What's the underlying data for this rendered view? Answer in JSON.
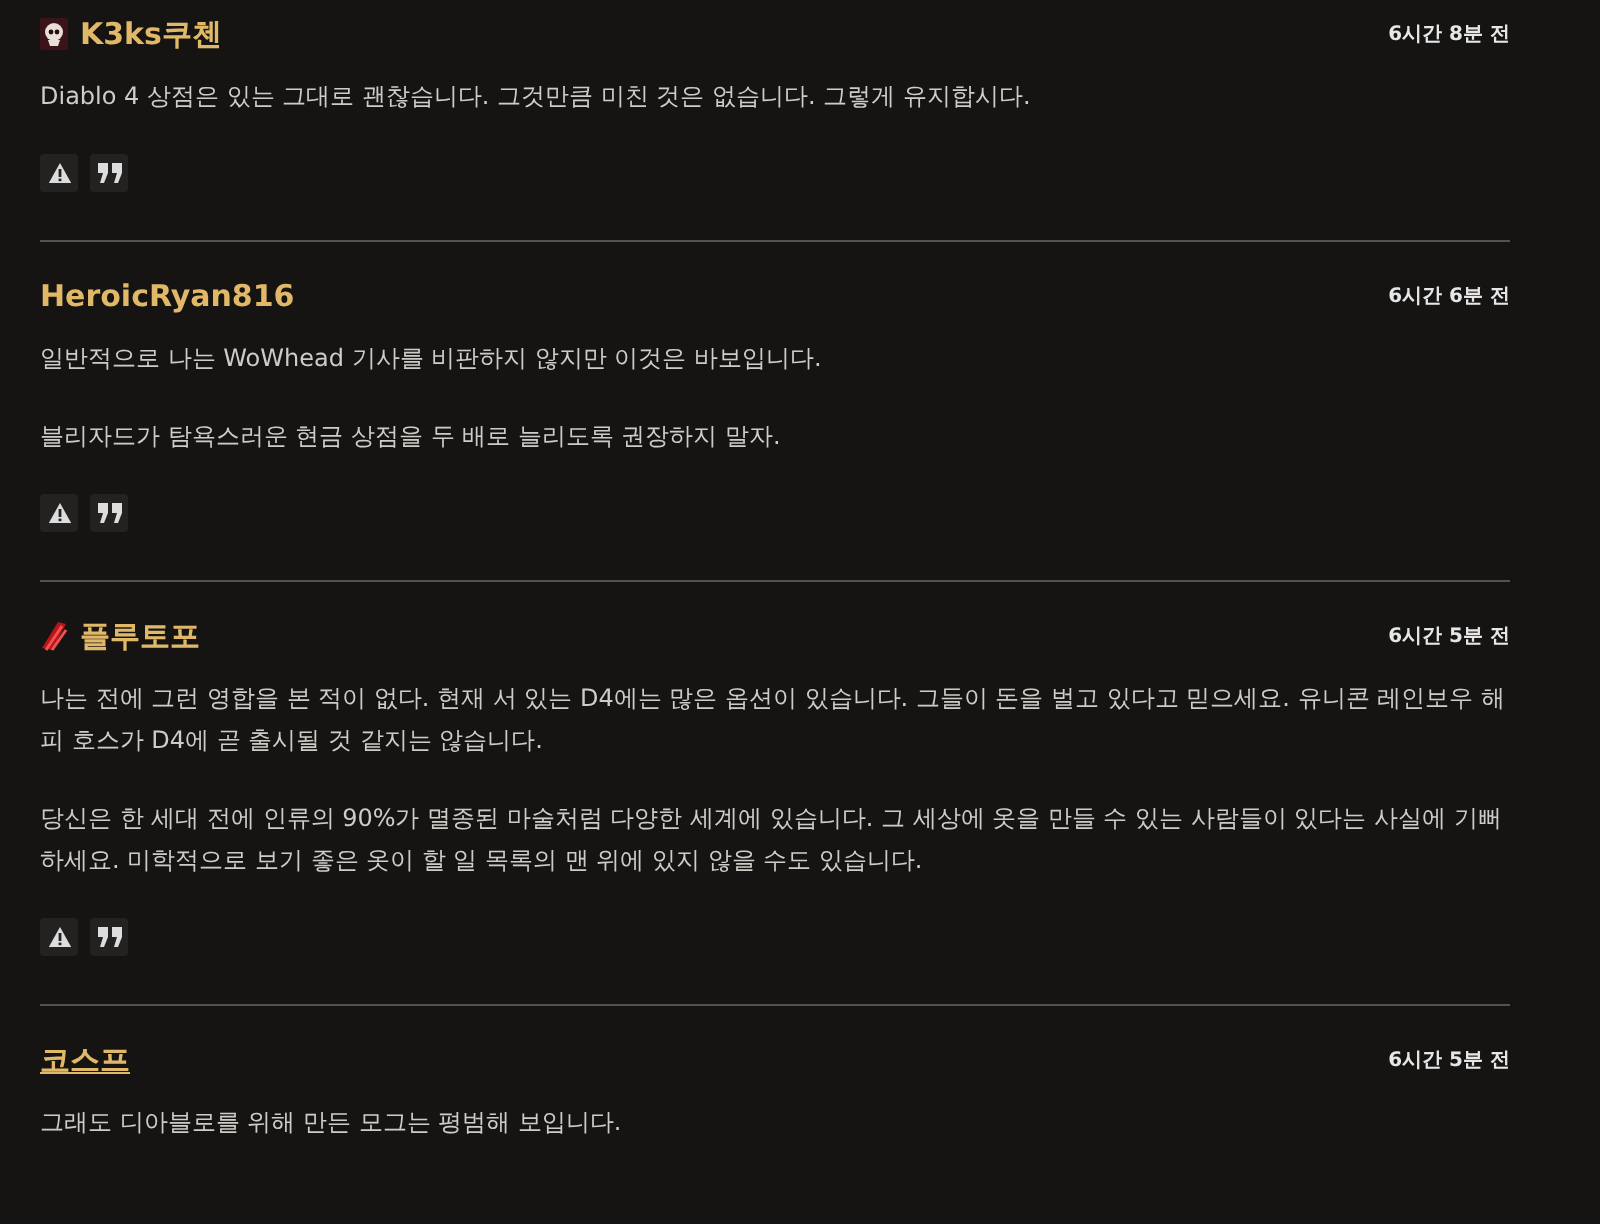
{
  "comments": [
    {
      "author": "K3ks쿠첸",
      "avatar": {
        "kind": "skull"
      },
      "underlined": false,
      "time": "6시간 8분 전",
      "paragraphs": [
        "Diablo 4 상점은 있는 그대로 괜찮습니다. 그것만큼 미친 것은 없습니다. 그렇게 유지합시다."
      ],
      "actions": true
    },
    {
      "author": "HeroicRyan816",
      "underlined": false,
      "time": "6시간 6분 전",
      "paragraphs": [
        "일반적으로 나는 WoWhead 기사를 비판하지 않지만 이것은 바보입니다.",
        "블리자드가 탐욕스러운 현금 상점을 두 배로 늘리도록 권장하지 말자."
      ],
      "actions": true
    },
    {
      "author": "플루토포",
      "avatar": {
        "kind": "claw"
      },
      "underlined": false,
      "time": "6시간 5분 전",
      "paragraphs": [
        "나는 전에 그런 영합을 본 적이 없다. 현재 서 있는 D4에는 많은 옵션이 있습니다. 그들이 돈을 벌고 있다고 믿으세요. 유니콘 레인보우 해피 호스가 D4에 곧 출시될 것 같지는 않습니다.",
        "당신은 한 세대 전에 인류의 90%가 멸종된 마술처럼 다양한 세계에 있습니다. 그 세상에 옷을 만들 수 있는 사람들이 있다는 사실에 기뻐하세요. 미학적으로 보기 좋은 옷이 할 일 목록의 맨 위에 있지 않을 수도 있습니다."
      ],
      "actions": true
    },
    {
      "author": "코스프",
      "underlined": true,
      "time": "6시간 5분 전",
      "paragraphs": [
        "그래도 디아블로를 위해 만든 모그는 평범해 보입니다."
      ],
      "actions": false
    }
  ]
}
